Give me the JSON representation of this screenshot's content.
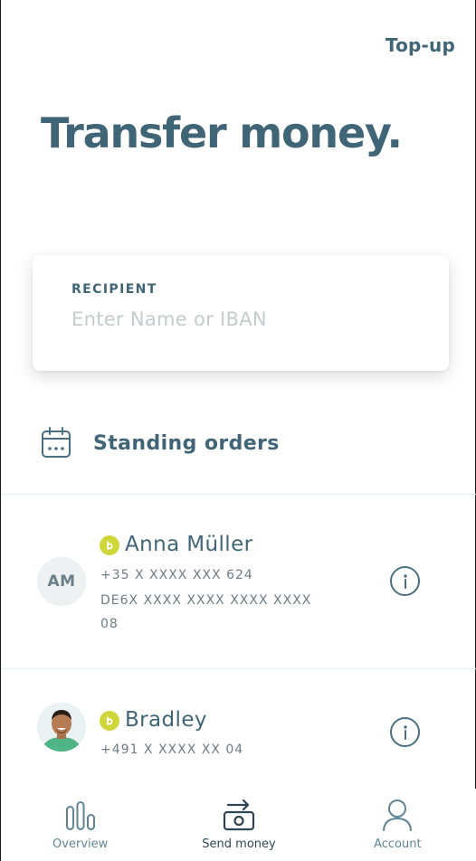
{
  "header": {
    "topup_label": "Top-up",
    "title": "Transfer money."
  },
  "recipient": {
    "label": "RECIPIENT",
    "placeholder": "Enter Name or IBAN"
  },
  "standing_orders": {
    "label": "Standing orders",
    "icon": "calendar-icon"
  },
  "contacts": [
    {
      "initials": "AM",
      "name": "Anna Müller",
      "phone": "+35 X XXXX XXX 624",
      "iban": "DE6X XXXX XXXX XXXX XXXX 08",
      "badge_letter": "b",
      "avatar_type": "initials"
    },
    {
      "name": "Bradley",
      "phone": "+491 X XXXX XX 04",
      "badge_letter": "b",
      "avatar_type": "photo"
    }
  ],
  "tabs": [
    {
      "label": "Overview",
      "icon": "bar-chart-icon",
      "active": false
    },
    {
      "label": "Send money",
      "icon": "send-money-icon",
      "active": true
    },
    {
      "label": "Account",
      "icon": "user-icon",
      "active": false
    }
  ],
  "colors": {
    "primary": "#3f6577",
    "badge": "#cfd63a",
    "placeholder": "#c3cbcd",
    "divider": "#e9eef0"
  }
}
